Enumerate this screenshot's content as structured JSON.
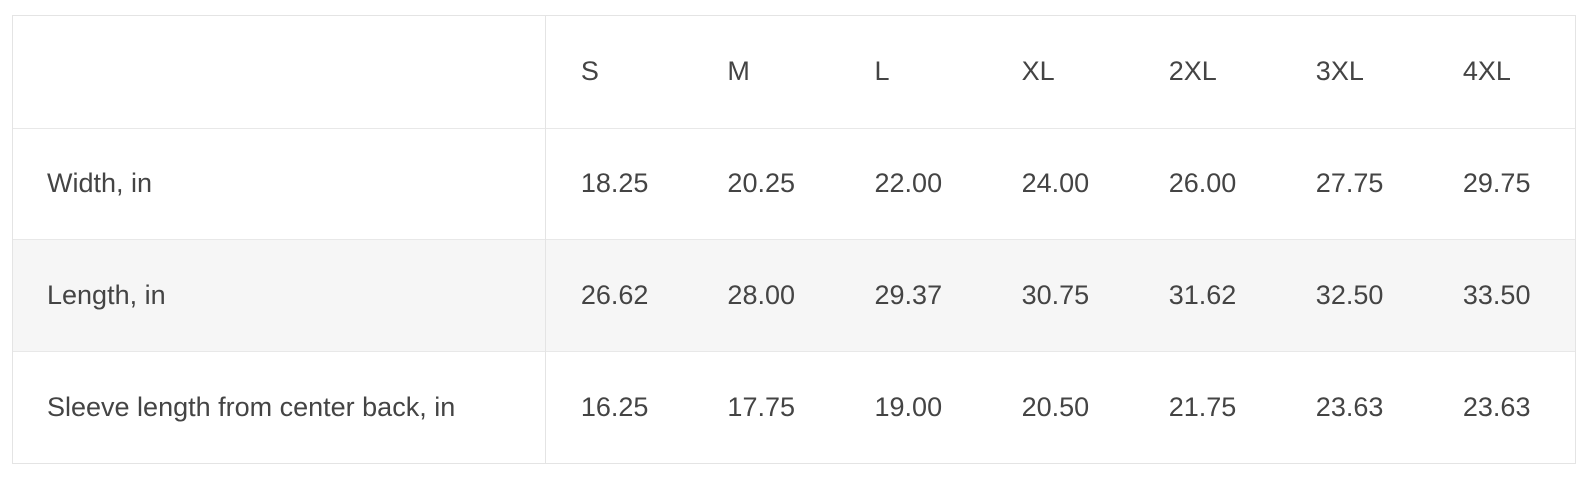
{
  "size_chart": {
    "corner_label": "",
    "sizes": [
      "S",
      "M",
      "L",
      "XL",
      "2XL",
      "3XL",
      "4XL"
    ],
    "rows": [
      {
        "label": "Width, in",
        "values": [
          "18.25",
          "20.25",
          "22.00",
          "24.00",
          "26.00",
          "27.75",
          "29.75"
        ]
      },
      {
        "label": "Length, in",
        "values": [
          "26.62",
          "28.00",
          "29.37",
          "30.75",
          "31.62",
          "32.50",
          "33.50"
        ]
      },
      {
        "label": "Sleeve length from center back, in",
        "values": [
          "16.25",
          "17.75",
          "19.00",
          "20.50",
          "21.75",
          "23.63",
          "23.63"
        ]
      }
    ]
  }
}
